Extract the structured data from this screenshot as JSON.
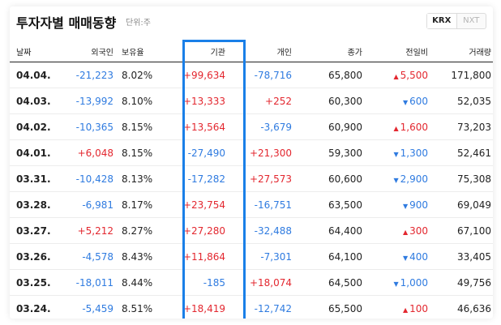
{
  "header": {
    "title": "투자자별 매매동향",
    "unit": "단위:주",
    "tabs": [
      {
        "label": "KRX",
        "active": true
      },
      {
        "label": "NXT",
        "active": false
      }
    ]
  },
  "table": {
    "columns": [
      "날짜",
      "외국인",
      "보유율",
      "기관",
      "개인",
      "종가",
      "전일비",
      "거래량"
    ],
    "rows": [
      {
        "date": "04.04.",
        "foreign": "-21,223",
        "ratio": "8.02%",
        "inst": "+99,634",
        "indiv": "-78,716",
        "close": "65,800",
        "change": "5,500",
        "dir": "up",
        "volume": "171,800"
      },
      {
        "date": "04.03.",
        "foreign": "-13,992",
        "ratio": "8.10%",
        "inst": "+13,333",
        "indiv": "+252",
        "close": "60,300",
        "change": "600",
        "dir": "down",
        "volume": "52,035"
      },
      {
        "date": "04.02.",
        "foreign": "-10,365",
        "ratio": "8.15%",
        "inst": "+13,564",
        "indiv": "-3,679",
        "close": "60,900",
        "change": "1,600",
        "dir": "up",
        "volume": "73,203"
      },
      {
        "date": "04.01.",
        "foreign": "+6,048",
        "ratio": "8.15%",
        "inst": "-27,490",
        "indiv": "+21,300",
        "close": "59,300",
        "change": "1,300",
        "dir": "down",
        "volume": "52,461"
      },
      {
        "date": "03.31.",
        "foreign": "-10,428",
        "ratio": "8.13%",
        "inst": "-17,282",
        "indiv": "+27,573",
        "close": "60,600",
        "change": "2,900",
        "dir": "down",
        "volume": "75,308"
      },
      {
        "date": "03.28.",
        "foreign": "-6,981",
        "ratio": "8.17%",
        "inst": "+23,754",
        "indiv": "-16,751",
        "close": "63,500",
        "change": "900",
        "dir": "down",
        "volume": "69,049"
      },
      {
        "date": "03.27.",
        "foreign": "+5,212",
        "ratio": "8.27%",
        "inst": "+27,280",
        "indiv": "-32,488",
        "close": "64,400",
        "change": "300",
        "dir": "up",
        "volume": "67,100"
      },
      {
        "date": "03.26.",
        "foreign": "-4,578",
        "ratio": "8.43%",
        "inst": "+11,864",
        "indiv": "-7,301",
        "close": "64,100",
        "change": "400",
        "dir": "down",
        "volume": "33,405"
      },
      {
        "date": "03.25.",
        "foreign": "-18,011",
        "ratio": "8.44%",
        "inst": "-185",
        "indiv": "+18,074",
        "close": "64,500",
        "change": "1,000",
        "dir": "down",
        "volume": "49,756"
      },
      {
        "date": "03.24.",
        "foreign": "-5,459",
        "ratio": "8.51%",
        "inst": "+18,419",
        "indiv": "-12,742",
        "close": "65,500",
        "change": "100",
        "dir": "up",
        "volume": "46,636"
      }
    ]
  },
  "colors": {
    "positive": "#e3272f",
    "negative": "#2f7be0",
    "highlight": "#1a7fe8"
  },
  "icons": {
    "up": "triangle-up-icon",
    "down": "triangle-down-icon"
  }
}
